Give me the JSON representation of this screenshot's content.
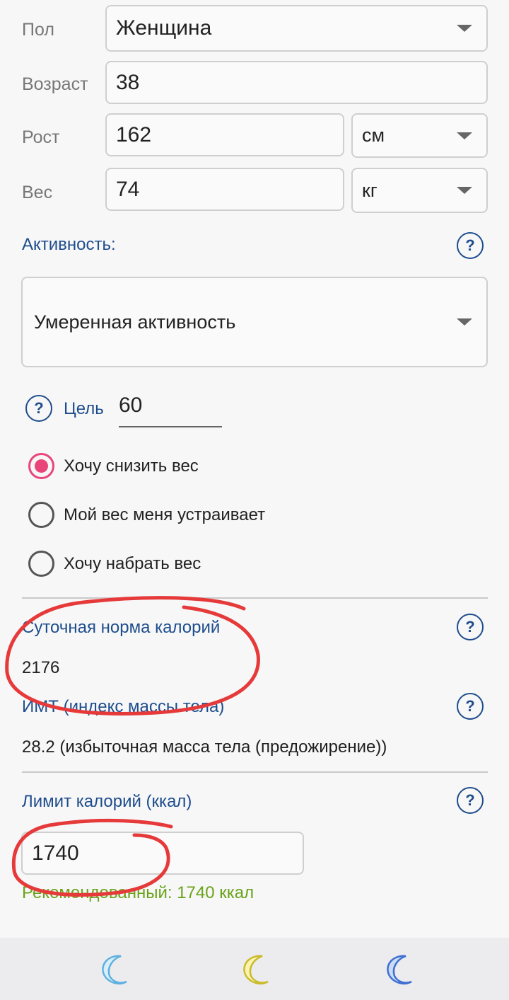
{
  "profile": {
    "gender_label": "Пол",
    "gender_value": "Женщина",
    "age_label": "Возраст",
    "age_value": "38",
    "height_label": "Рост",
    "height_value": "162",
    "height_unit": "см",
    "weight_label": "Вес",
    "weight_value": "74",
    "weight_unit": "кг"
  },
  "activity": {
    "label": "Активность:",
    "value": "Умеренная активность",
    "help": "?"
  },
  "goal": {
    "help": "?",
    "label": "Цель",
    "value": "60",
    "options": [
      {
        "label": "Хочу снизить вес",
        "selected": true
      },
      {
        "label": "Мой вес меня устраивает",
        "selected": false
      },
      {
        "label": "Хочу набрать вес",
        "selected": false
      }
    ]
  },
  "results": {
    "daily_norm_label": "Суточная норма калорий",
    "daily_norm_value": "2176",
    "daily_help": "?",
    "bmi_label": "ИМТ (индекс массы тела)",
    "bmi_value": "28.2 (избыточная масса тела (предожирение))",
    "bmi_help": "?"
  },
  "limit": {
    "label": "Лимит калорий (ккал)",
    "help": "?",
    "value": "1740",
    "recommended": "Рекомендованный: 1740 ккал"
  },
  "colors": {
    "accent_blue": "#1e4d8c",
    "radio_selected": "#e8457a",
    "recommended_green": "#6aa31a",
    "annotation_red": "#e63a3a"
  },
  "bottom_nav": {
    "items": [
      "moon-light-blue-icon",
      "moon-yellow-icon",
      "moon-blue-icon"
    ]
  }
}
